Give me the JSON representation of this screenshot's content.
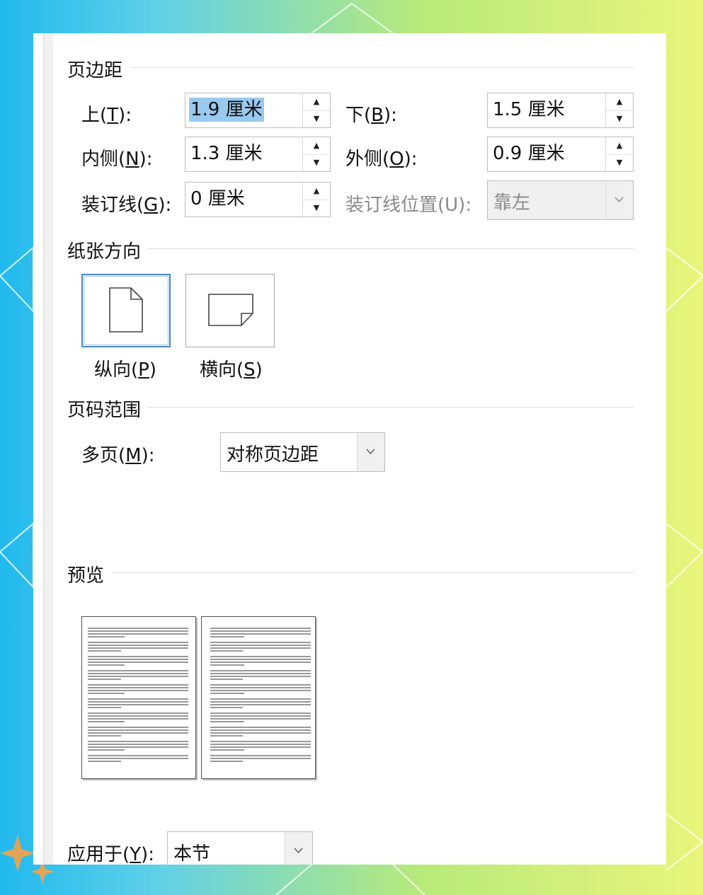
{
  "sections": {
    "margins": "页边距",
    "orientation": "纸张方向",
    "pages": "页码范围",
    "preview": "预览"
  },
  "margins": {
    "top": {
      "label": "上(",
      "key": "T",
      "suffix": "):",
      "value": "1.9 厘米"
    },
    "bottom": {
      "label": "下(",
      "key": "B",
      "suffix": "):",
      "value": "1.5 厘米"
    },
    "inside": {
      "label": "内侧(",
      "key": "N",
      "suffix": "):",
      "value": "1.3 厘米"
    },
    "outside": {
      "label": "外侧(",
      "key": "O",
      "suffix": "):",
      "value": "0.9 厘米"
    },
    "gutter": {
      "label": "装订线(",
      "key": "G",
      "suffix": "):",
      "value": "0 厘米"
    },
    "gutter_position": {
      "label": "装订线位置(U):",
      "value": "靠左"
    }
  },
  "orientation": {
    "portrait": {
      "label": "纵向(",
      "key": "P",
      "suffix": ")",
      "selected": true
    },
    "landscape": {
      "label": "横向(",
      "key": "S",
      "suffix": ")",
      "selected": false
    }
  },
  "pages": {
    "multiple": {
      "label": "多页(",
      "key": "M",
      "suffix": "):",
      "value": "对称页边距"
    }
  },
  "apply": {
    "label": "应用于(",
    "key": "Y",
    "suffix": "):",
    "value": "本节"
  },
  "icons": {
    "spin_up": "▲",
    "spin_down": "▼"
  },
  "colors": {
    "selection": "#99c9ef",
    "selected_border": "#4a86c6"
  }
}
